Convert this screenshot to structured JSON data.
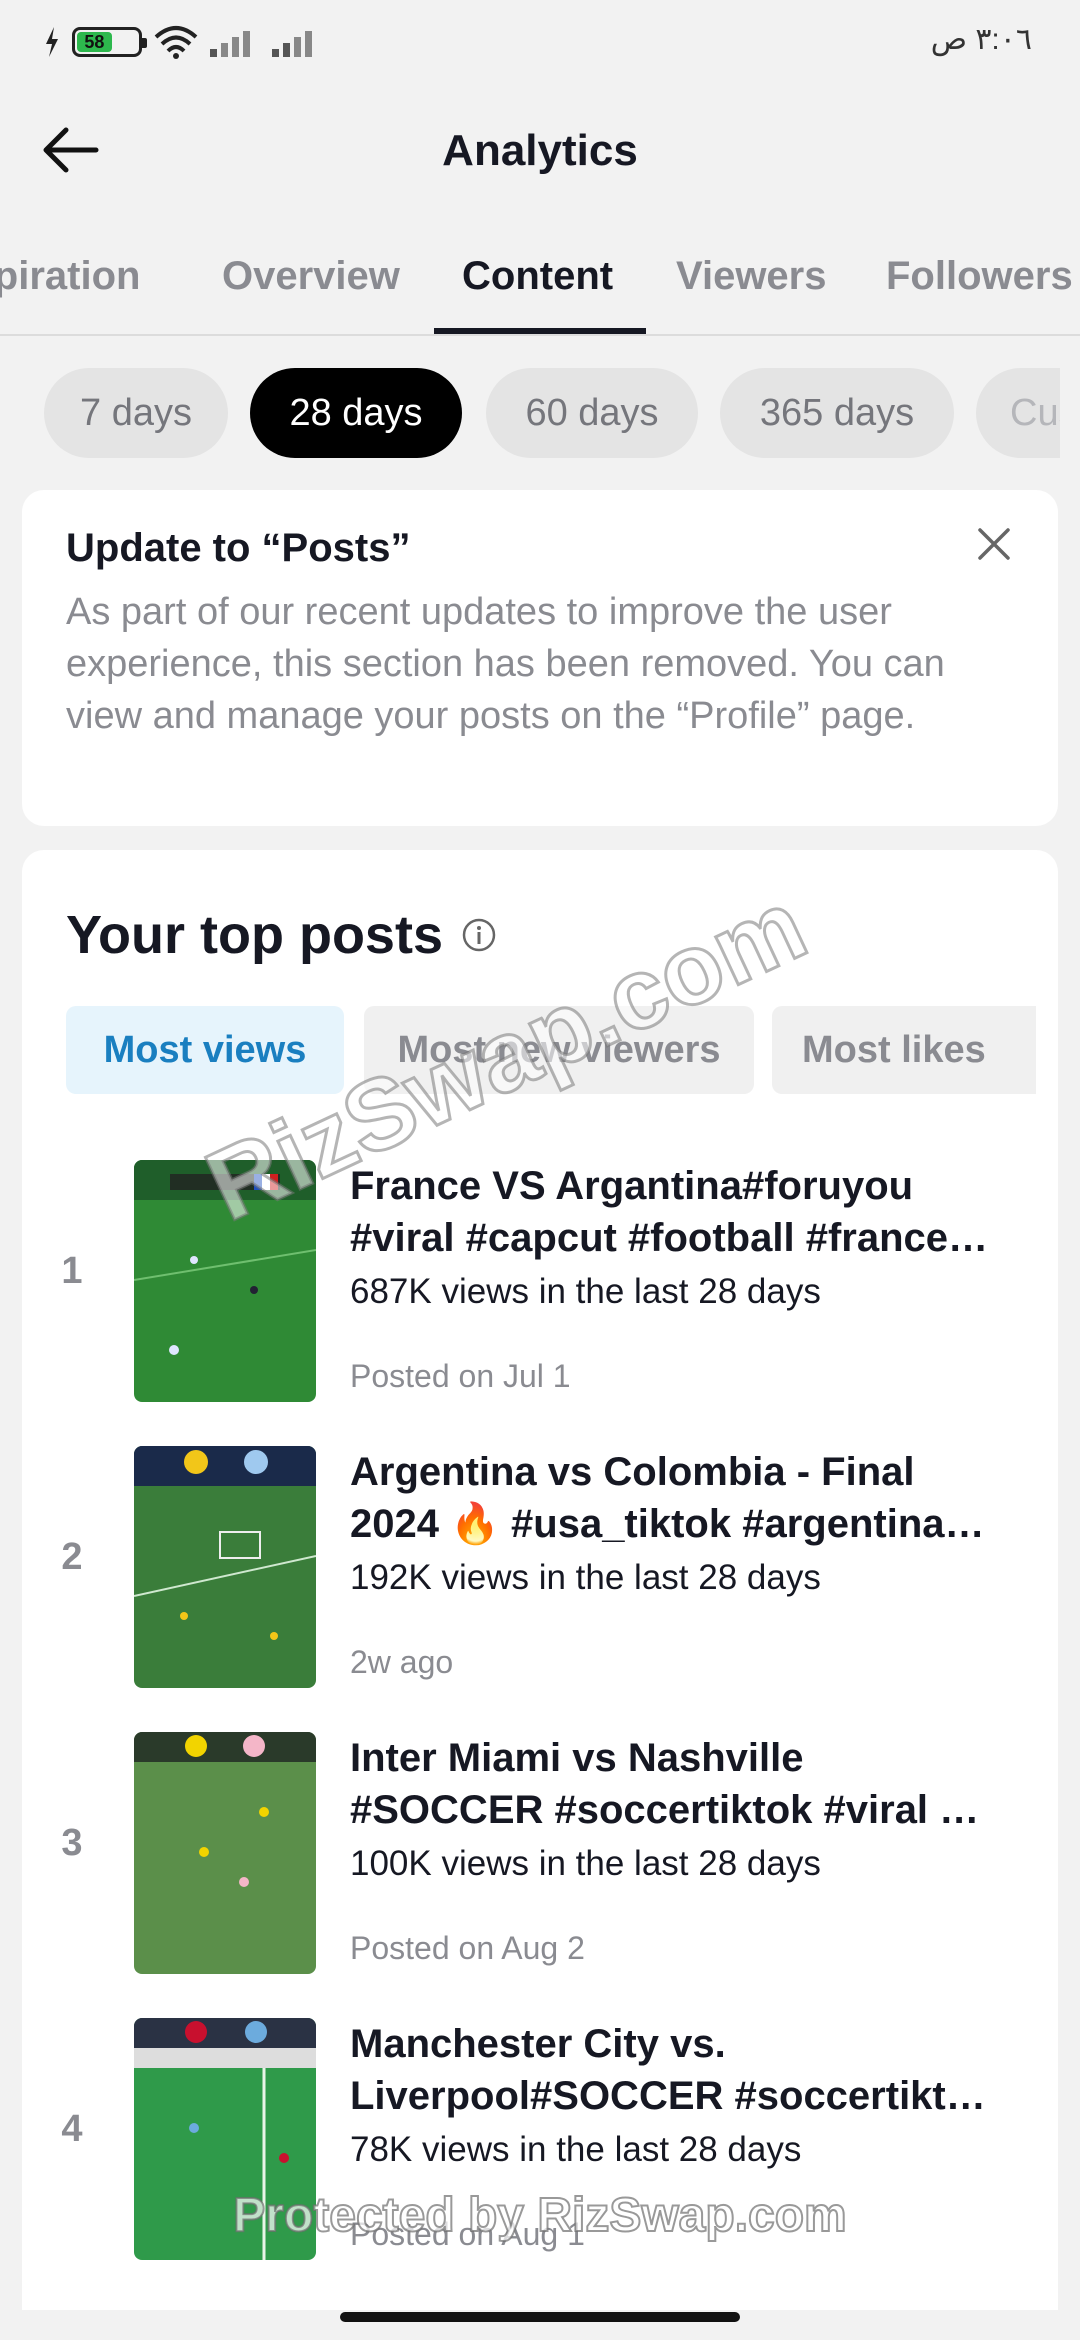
{
  "status_bar": {
    "battery": "58",
    "time": "٣:٠٦ ص"
  },
  "header": {
    "title": "Analytics"
  },
  "tabs": [
    {
      "label": "Inspiration"
    },
    {
      "label": "Overview"
    },
    {
      "label": "Content"
    },
    {
      "label": "Viewers"
    },
    {
      "label": "Followers"
    }
  ],
  "period_chips": [
    {
      "label": "7 days"
    },
    {
      "label": "28 days"
    },
    {
      "label": "60 days"
    },
    {
      "label": "365 days"
    },
    {
      "label": "Custom"
    }
  ],
  "notice": {
    "title": "Update to “Posts”",
    "body": "As part of our recent updates to improve the user experience, this section has been removed. You can view and manage your posts on the “Profile” page."
  },
  "top_posts": {
    "title": "Your top posts",
    "sort_tabs": [
      {
        "label": "Most views"
      },
      {
        "label": "Most new viewers"
      },
      {
        "label": "Most likes"
      }
    ],
    "posts": [
      {
        "rank": "1",
        "title_line1": "France VS Argantina#foruyou",
        "title_line2": "#viral #capcut #football #francе…",
        "views": "687K views in the last 28 days",
        "date": "Posted on Jul 1"
      },
      {
        "rank": "2",
        "title_line1": "Argentina vs Colombia - Final",
        "title_line2": "2024 🔥 #usa_tiktok #argentina…",
        "views": "192K views in the last 28 days",
        "date": "2w ago"
      },
      {
        "rank": "3",
        "title_line1": "Inter Miami vs Nashville",
        "title_line2": "#SOCCER #soccertiktok #viral …",
        "views": "100K views in the last 28 days",
        "date": "Posted on Aug 2"
      },
      {
        "rank": "4",
        "title_line1": "Manchester City vs.",
        "title_line2": "Liverpool#SOCCER #soccertikt…",
        "views": "78K views in the last 28 days",
        "date": "Posted on Aug 1"
      }
    ]
  },
  "watermarks": {
    "diagonal": "RizSwap.com",
    "bottom": "Protected by RizSwap.com"
  }
}
